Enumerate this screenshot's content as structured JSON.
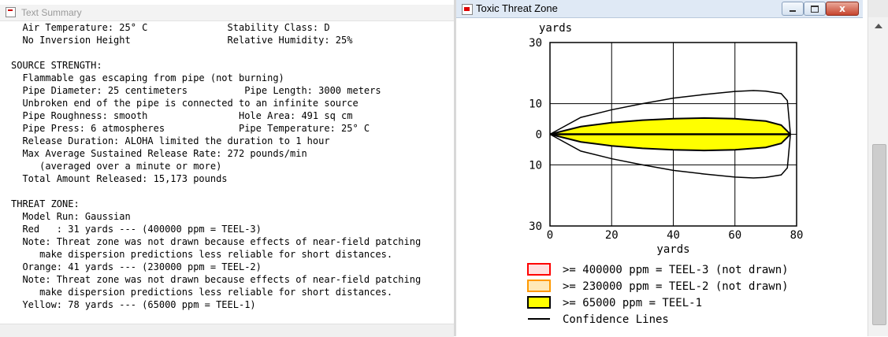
{
  "left_window": {
    "title": "Text Summary",
    "lines": [
      "  Air Temperature: 25° C              Stability Class: D",
      "  No Inversion Height                 Relative Humidity: 25%",
      "",
      "SOURCE STRENGTH:",
      "  Flammable gas escaping from pipe (not burning)",
      "  Pipe Diameter: 25 centimeters          Pipe Length: 3000 meters",
      "  Unbroken end of the pipe is connected to an infinite source",
      "  Pipe Roughness: smooth                Hole Area: 491 sq cm",
      "  Pipe Press: 6 atmospheres             Pipe Temperature: 25° C",
      "  Release Duration: ALOHA limited the duration to 1 hour",
      "  Max Average Sustained Release Rate: 272 pounds/min",
      "     (averaged over a minute or more)",
      "  Total Amount Released: 15,173 pounds",
      "",
      "THREAT ZONE:",
      "  Model Run: Gaussian",
      "  Red   : 31 yards --- (400000 ppm = TEEL-3)",
      "  Note: Threat zone was not drawn because effects of near-field patching",
      "     make dispersion predictions less reliable for short distances.",
      "  Orange: 41 yards --- (230000 ppm = TEEL-2)",
      "  Note: Threat zone was not drawn because effects of near-field patching",
      "     make dispersion predictions less reliable for short distances.",
      "  Yellow: 78 yards --- (65000 ppm = TEEL-1)"
    ]
  },
  "right_window": {
    "title": "Toxic Threat Zone",
    "close_label": "x"
  },
  "chart_data": {
    "type": "area",
    "xlabel": "yards",
    "ylabel": "yards",
    "xlim": [
      0,
      80
    ],
    "ylim": [
      -30,
      30
    ],
    "x_ticks": [
      0,
      20,
      40,
      60,
      80
    ],
    "y_ticks": [
      {
        "value": 30,
        "label": "30"
      },
      {
        "value": 10,
        "label": "10"
      },
      {
        "value": 0,
        "label": "0"
      },
      {
        "value": -10,
        "label": "10"
      },
      {
        "value": -30,
        "label": "30"
      }
    ],
    "grid": true,
    "yellow_zone": {
      "x": [
        0,
        10,
        20,
        30,
        40,
        50,
        60,
        70,
        75,
        78
      ],
      "half_width": [
        0,
        2.5,
        3.8,
        4.6,
        5.1,
        5.3,
        5.1,
        4.3,
        3.0,
        0
      ]
    },
    "confidence_lines": {
      "x": [
        0,
        10,
        20,
        30,
        40,
        50,
        60,
        66,
        70,
        75,
        77,
        78
      ],
      "half_width": [
        0,
        5.5,
        8,
        10,
        11.8,
        13,
        14,
        14.3,
        14.1,
        13.3,
        11,
        0
      ]
    },
    "legend": [
      {
        "label": ">= 400000 ppm = TEEL-3 (not drawn)",
        "color": "#ff0000",
        "fill": "#ffe0e0"
      },
      {
        "label": ">= 230000 ppm = TEEL-2 (not drawn)",
        "color": "#ff9900",
        "fill": "#ffe9b8"
      },
      {
        "label": ">= 65000 ppm = TEEL-1",
        "color": "#000000",
        "fill": "#ffff00"
      },
      {
        "label": "Confidence Lines",
        "color": "#000000",
        "fill": ""
      }
    ]
  }
}
